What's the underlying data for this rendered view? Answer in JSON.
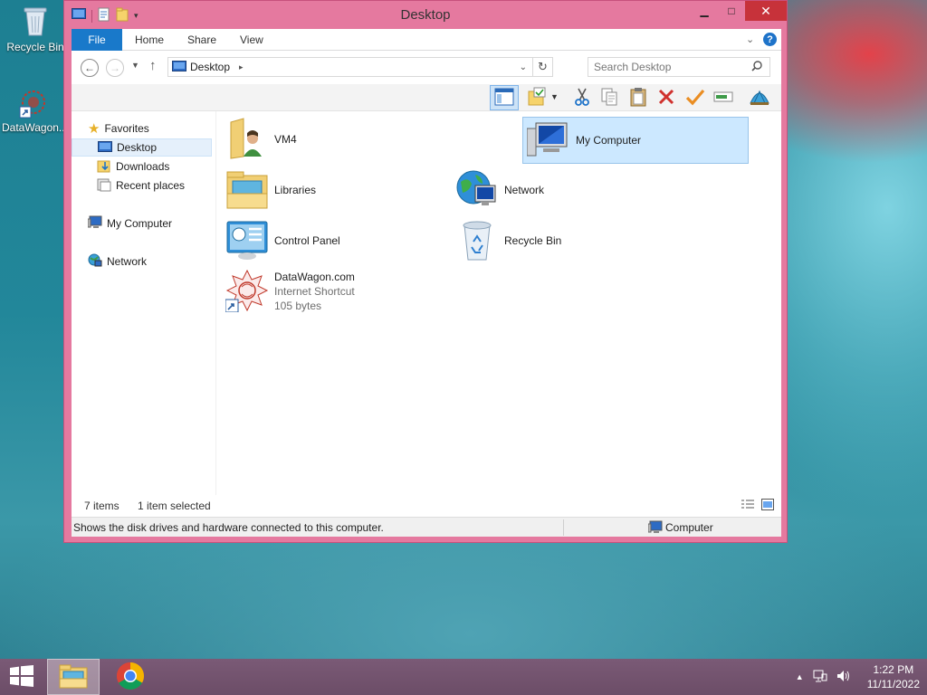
{
  "desktop": {
    "icons": [
      {
        "label": "Recycle Bin"
      },
      {
        "label": "DataWagon..."
      }
    ]
  },
  "window": {
    "title": "Desktop",
    "ribbon_tabs": [
      "File",
      "Home",
      "Share",
      "View"
    ],
    "address": "Desktop",
    "search_placeholder": "Search Desktop",
    "nav": {
      "favorites": "Favorites",
      "desktop": "Desktop",
      "downloads": "Downloads",
      "recent": "Recent places",
      "computer": "My Computer",
      "network": "Network"
    },
    "items": [
      {
        "name": "VM4"
      },
      {
        "name": "My Computer"
      },
      {
        "name": "Libraries"
      },
      {
        "name": "Network"
      },
      {
        "name": "Control Panel"
      },
      {
        "name": "Recycle Bin"
      },
      {
        "name": "DataWagon.com",
        "type": "Internet Shortcut",
        "size": "105 bytes"
      }
    ],
    "status": {
      "count": "7 items",
      "selected": "1 item selected"
    },
    "details": {
      "description": "Shows the disk drives and hardware connected to this computer.",
      "location": "Computer"
    }
  },
  "taskbar": {
    "time": "1:22 PM",
    "date": "11/11/2022"
  },
  "colors": {
    "window_frame": "#e5799f",
    "accent": "#1979ca",
    "selection": "#cce8ff",
    "taskbar": "#6c4d67"
  }
}
